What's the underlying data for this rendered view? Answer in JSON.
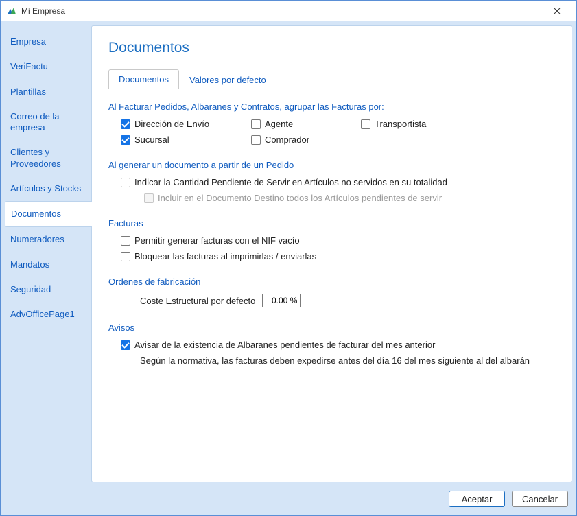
{
  "window": {
    "title": "Mi Empresa"
  },
  "sidebar": {
    "items": [
      {
        "label": "Empresa"
      },
      {
        "label": "VeriFactu"
      },
      {
        "label": "Plantillas"
      },
      {
        "label": "Correo de la empresa"
      },
      {
        "label": "Clientes y Proveedores"
      },
      {
        "label": "Artículos y Stocks"
      },
      {
        "label": "Documentos"
      },
      {
        "label": "Numeradores"
      },
      {
        "label": "Mandatos"
      },
      {
        "label": "Seguridad"
      },
      {
        "label": "AdvOfficePage1"
      }
    ],
    "active_index": 6
  },
  "page": {
    "title": "Documentos"
  },
  "tabs": {
    "items": [
      {
        "label": "Documentos"
      },
      {
        "label": "Valores por defecto"
      }
    ],
    "active_index": 0
  },
  "group_invoices": {
    "title": "Al Facturar Pedidos, Albaranes y Contratos, agrupar las Facturas por:",
    "options": {
      "direccion_envio": {
        "label": "Dirección de Envío",
        "checked": true
      },
      "agente": {
        "label": "Agente",
        "checked": false
      },
      "transportista": {
        "label": "Transportista",
        "checked": false
      },
      "sucursal": {
        "label": "Sucursal",
        "checked": true
      },
      "comprador": {
        "label": "Comprador",
        "checked": false
      }
    }
  },
  "gen_from_order": {
    "title": "Al generar un documento a partir de un Pedido",
    "indicate_pending": {
      "label": "Indicar la Cantidad Pendiente de Servir en Artículos no servidos en su totalidad",
      "checked": false
    },
    "include_all_pending": {
      "label": "Incluir en el Documento Destino todos los Artículos pendientes de servir",
      "checked": false,
      "disabled": true
    }
  },
  "facturas": {
    "title": "Facturas",
    "allow_empty_nif": {
      "label": "Permitir generar facturas con el NIF vacío",
      "checked": false
    },
    "lock_on_print": {
      "label": "Bloquear las facturas al imprimirlas / enviarlas",
      "checked": false
    }
  },
  "ordenes": {
    "title": "Ordenes de fabricación",
    "cost_label": "Coste Estructural por defecto",
    "cost_value": "0.00 %"
  },
  "avisos": {
    "title": "Avisos",
    "warn_pending_albaranes": {
      "label": "Avisar de la existencia de Albaranes pendientes de facturar del mes anterior",
      "checked": true
    },
    "note": "Según la normativa, las facturas deben expedirse antes del día 16 del mes siguiente al del albarán"
  },
  "footer": {
    "accept": "Aceptar",
    "cancel": "Cancelar"
  }
}
